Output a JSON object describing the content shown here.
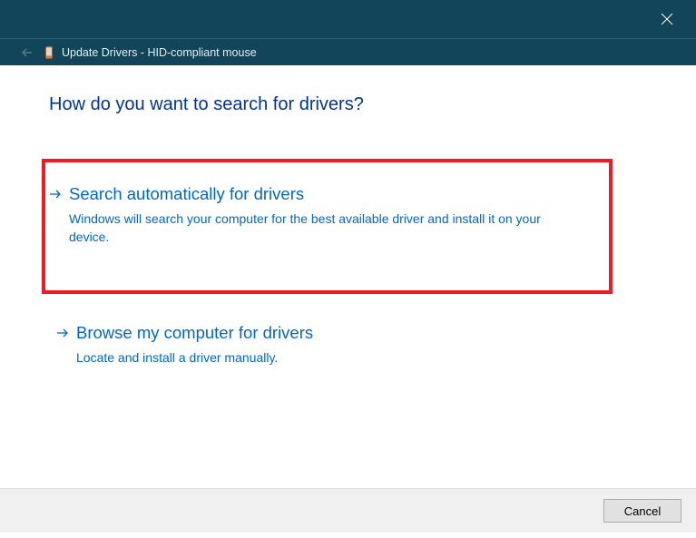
{
  "colors": {
    "titlebar_bg": "#124559",
    "link_blue": "#0066cc",
    "heading_blue": "#003399",
    "highlight_border": "#ed1c24"
  },
  "window": {
    "title": "Update Drivers - HID-compliant mouse"
  },
  "heading": "How do you want to search for drivers?",
  "options": [
    {
      "title": "Search automatically for drivers",
      "description": "Windows will search your computer for the best available driver and install it on your device.",
      "highlighted": true
    },
    {
      "title": "Browse my computer for drivers",
      "description": "Locate and install a driver manually.",
      "highlighted": false
    }
  ],
  "buttons": {
    "cancel": "Cancel"
  }
}
